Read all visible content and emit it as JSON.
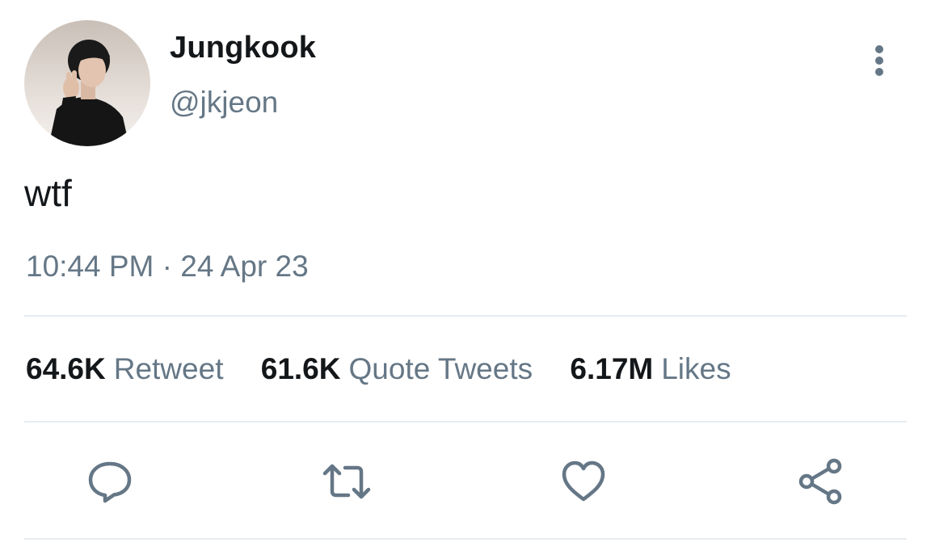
{
  "author": {
    "name": "Jungkook",
    "handle": "@jkjeon",
    "avatar_icon": "profile-photo"
  },
  "tweet": {
    "text": "wtf",
    "time": "10:44 PM",
    "separator": "·",
    "date": "24 Apr 23"
  },
  "stats": [
    {
      "count": "64.6K",
      "label": "Retweet"
    },
    {
      "count": "61.6K",
      "label": "Quote Tweets"
    },
    {
      "count": "6.17M",
      "label": "Likes"
    }
  ],
  "actions": {
    "reply_icon": "reply-icon",
    "retweet_icon": "retweet-icon",
    "like_icon": "heart-icon",
    "share_icon": "share-icon"
  },
  "colors": {
    "primary_text": "#14171a",
    "secondary_text": "#657786",
    "divider": "#e6ecf0",
    "background": "#ffffff"
  }
}
